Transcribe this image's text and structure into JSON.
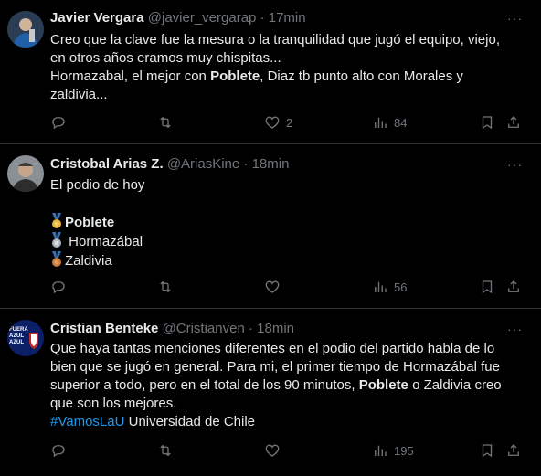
{
  "tweets": [
    {
      "name": "Javier Vergara",
      "handle": "@javier_vergarap",
      "time": "17min",
      "lines": {
        "l1": "Creo que la clave fue la mesura o la tranquilidad que jugó el equipo, viejo,",
        "l2": "en otros años eramos muy chispitas...",
        "l3a": "Hormazabal, el mejor con ",
        "l3b": "Poblete",
        "l3c": ", Diaz tb punto alto con Morales y",
        "l4": "zaldivia..."
      },
      "likes": "2",
      "views": "84"
    },
    {
      "name": "Cristobal Arias Z.",
      "handle": "@AriasKine",
      "time": "18min",
      "lines": {
        "l1": "El podio de hoy",
        "p1": "Poblete",
        "p2": "Hormazábal",
        "p3": "Zaldivia"
      },
      "likes": "",
      "views": "56"
    },
    {
      "name": "Cristian Benteke",
      "handle": "@Cristianven",
      "time": "18min",
      "avatar_text": "FUERA AZUL AZUL",
      "lines": {
        "l1": "Que haya tantas menciones diferentes en el podio del partido habla de lo",
        "l2": "bien que se jugó en general.  Para mi, el primer tiempo de Hormazábal fue",
        "l3": "superior a todo, pero en el total de los 90 minutos, ",
        "l3b": "Poblete",
        "l3c": " o Zaldivia creo",
        "l4": "que son los mejores.",
        "hashtag": "#VamosLaU",
        "l5": " Universidad de Chile"
      },
      "likes": "",
      "views": "195"
    }
  ],
  "dot": "·",
  "more": "···",
  "colors": {
    "bg": "#000000",
    "text": "#e7e9ea",
    "muted": "#71767b",
    "link": "#1d9bf0",
    "divider": "#2f3336"
  }
}
